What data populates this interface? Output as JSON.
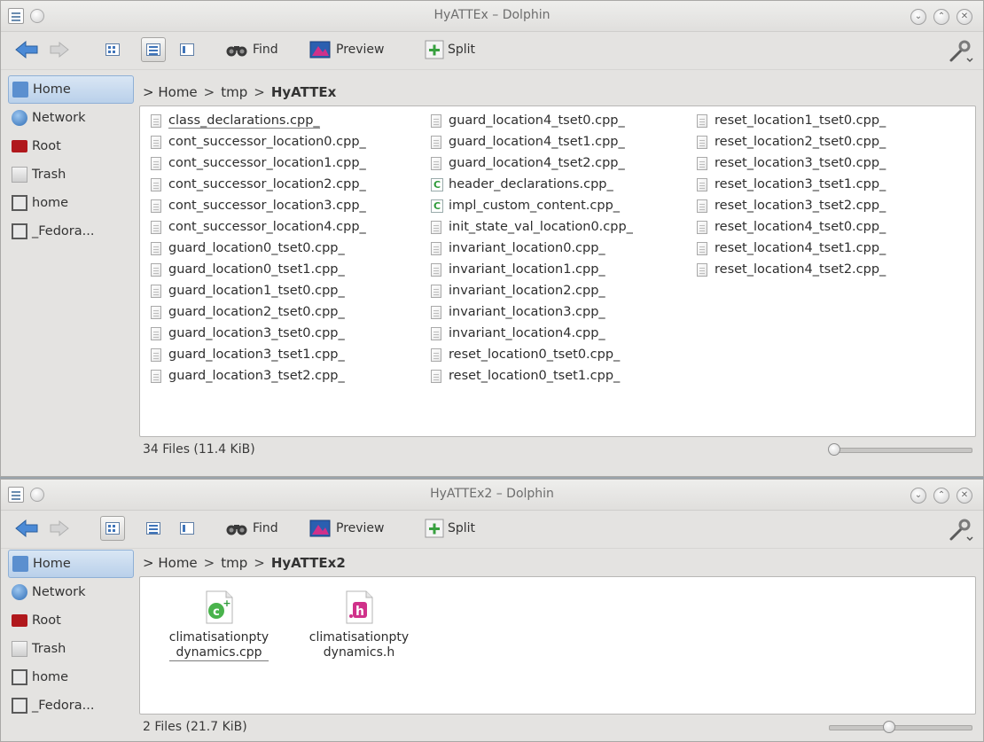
{
  "windows": [
    {
      "title": "HyATTEx – Dolphin",
      "toolbar": {
        "find": "Find",
        "preview": "Preview",
        "split": "Split"
      },
      "places": [
        "Home",
        "Network",
        "Root",
        "Trash",
        "home",
        "_Fedora..."
      ],
      "breadcrumb": {
        "sep": ">",
        "home": "Home",
        "tmp": "tmp",
        "current": "HyATTEx"
      },
      "files": {
        "col1": [
          "class_declarations.cpp_",
          "cont_successor_location0.cpp_",
          "cont_successor_location1.cpp_",
          "cont_successor_location2.cpp_",
          "cont_successor_location3.cpp_",
          "cont_successor_location4.cpp_",
          "guard_location0_tset0.cpp_",
          "guard_location0_tset1.cpp_",
          "guard_location1_tset0.cpp_",
          "guard_location2_tset0.cpp_",
          "guard_location3_tset0.cpp_",
          "guard_location3_tset1.cpp_",
          "guard_location3_tset2.cpp_"
        ],
        "col2": [
          "guard_location4_tset0.cpp_",
          "guard_location4_tset1.cpp_",
          "guard_location4_tset2.cpp_",
          "header_declarations.cpp_",
          "impl_custom_content.cpp_",
          "init_state_val_location0.cpp_",
          "invariant_location0.cpp_",
          "invariant_location1.cpp_",
          "invariant_location2.cpp_",
          "invariant_location3.cpp_",
          "invariant_location4.cpp_",
          "reset_location0_tset0.cpp_",
          "reset_location0_tset1.cpp_"
        ],
        "col3": [
          "reset_location1_tset0.cpp_",
          "reset_location2_tset0.cpp_",
          "reset_location3_tset0.cpp_",
          "reset_location3_tset1.cpp_",
          "reset_location3_tset2.cpp_",
          "reset_location4_tset0.cpp_",
          "reset_location4_tset1.cpp_",
          "reset_location4_tset2.cpp_"
        ]
      },
      "status": "34 Files (11.4 KiB)"
    },
    {
      "title": "HyATTEx2 – Dolphin",
      "toolbar": {
        "find": "Find",
        "preview": "Preview",
        "split": "Split"
      },
      "places": [
        "Home",
        "Network",
        "Root",
        "Trash",
        "home",
        "_Fedora..."
      ],
      "breadcrumb": {
        "sep": ">",
        "home": "Home",
        "tmp": "tmp",
        "current": "HyATTEx2"
      },
      "icons": [
        {
          "line1": "climatisationpty",
          "line2": "dynamics.cpp",
          "type": "cpp-source-icon"
        },
        {
          "line1": "climatisationpty",
          "line2": "dynamics.h",
          "type": "header-file-icon"
        }
      ],
      "status": "2 Files (21.7 KiB)"
    }
  ],
  "colors": {
    "accent": "#3f74b9",
    "cpp_green": "#2e9b3a",
    "header_pink": "#d0318a",
    "root_red": "#b0181c"
  }
}
